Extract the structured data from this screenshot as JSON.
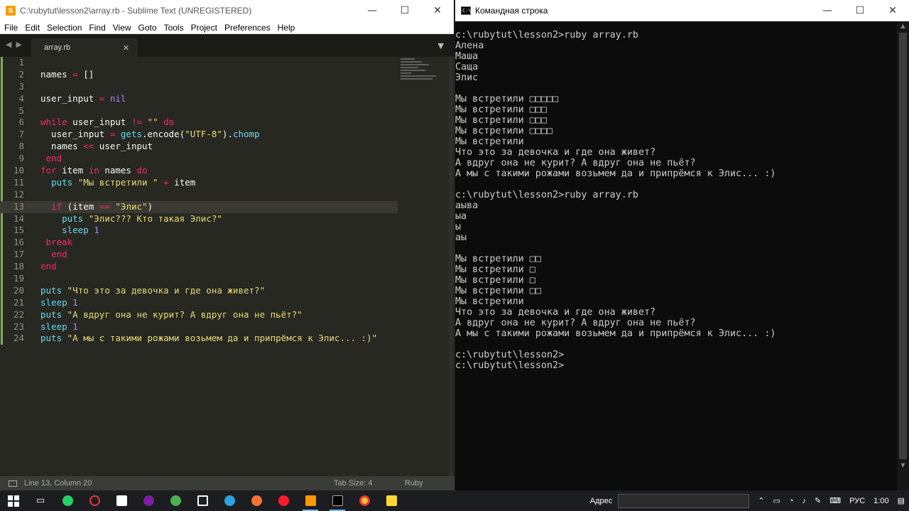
{
  "sublime": {
    "title": "C:\\rubytut\\lesson2\\array.rb - Sublime Text (UNREGISTERED)",
    "menu": [
      "File",
      "Edit",
      "Selection",
      "Find",
      "View",
      "Goto",
      "Tools",
      "Project",
      "Preferences",
      "Help"
    ],
    "tab_name": "array.rb",
    "status_position": "Line 13, Column 20",
    "tab_size": "Tab Size: 4",
    "syntax": "Ruby",
    "current_line": 13,
    "line_numbers": [
      "1",
      "2",
      "3",
      "4",
      "5",
      "6",
      "7",
      "8",
      "9",
      "10",
      "11",
      "12",
      "13",
      "14",
      "15",
      "16",
      "17",
      "18",
      "19",
      "20",
      "21",
      "22",
      "23",
      "24"
    ]
  },
  "cmd": {
    "title": "Командная строка",
    "lines": [
      "c:\\rubytut\\lesson2>ruby array.rb",
      "Алена",
      "Маша",
      "Саща",
      "Элис",
      "",
      "Мы встретили □□□□□",
      "Мы встретили □□□",
      "Мы встретили □□□",
      "Мы встретили □□□□",
      "Мы встретили",
      "Что это за девочка и где она живет?",
      "А вдруг она не курит? А вдруг она не пьёт?",
      "А мы с такими рожами возьмем да и припрёмся к Элис... :)",
      "",
      "c:\\rubytut\\lesson2>ruby array.rb",
      "аыва",
      "ыа",
      "ы",
      "аы",
      "",
      "Мы встретили □□",
      "Мы встретили □",
      "Мы встретили □",
      "Мы встретили □□",
      "Мы встретили",
      "Что это за девочка и где она живет?",
      "А вдруг она не курит? А вдруг она не пьёт?",
      "А мы с такими рожами возьмем да и припрёмся к Элис... :)",
      "",
      "c:\\rubytut\\lesson2>",
      "c:\\rubytut\\lesson2>"
    ]
  },
  "taskbar": {
    "address_label": "Адрес",
    "language": "РУС",
    "time": "1:00"
  },
  "window_buttons": {
    "minimize": "—",
    "maximize": "☐",
    "close": "✕"
  },
  "colors": {
    "keyword": "#f92672",
    "string": "#e6db74",
    "function": "#66d9ef",
    "number": "#ae81ff",
    "editor_bg": "#272822",
    "console_bg": "#0c0c0c"
  }
}
